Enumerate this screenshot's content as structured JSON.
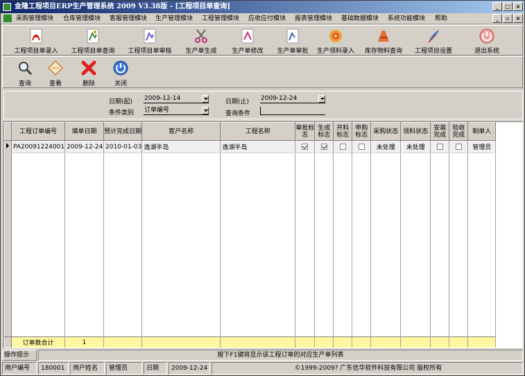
{
  "window": {
    "title": "金隆工程项目ERP生产管理系统 2009 V3.38版 - [工程项目单查询]"
  },
  "menu": [
    "采购管理模块",
    "仓库管理模块",
    "客服管理模块",
    "生产管理模块",
    "工程管理模块",
    "应收应付模块",
    "报表管理模块",
    "基础数据模块",
    "系统功能模块",
    "帮助"
  ],
  "toolbar": [
    "工程项目单录入",
    "工程项目单查询",
    "工程项目单审核",
    "生产单生成",
    "生产单修改",
    "生产单审批",
    "生产领料录入",
    "库存物料查询",
    "工程项目设置",
    "退出系统"
  ],
  "actions": [
    "查询",
    "查看",
    "删除",
    "关闭"
  ],
  "filter": {
    "date_from_label": "日期(起)",
    "date_from": "2009-12-14",
    "date_to_label": "日期(止)",
    "date_to": "2009-12-24",
    "category_label": "条件类别",
    "category": "订单编号",
    "condition_label": "查询条件",
    "condition": ""
  },
  "grid": {
    "columns": [
      "工程订单编号",
      "填单日期",
      "预计完成日期",
      "客户名称",
      "工程名称",
      "审批标志",
      "生成标志",
      "开料标志",
      "申购标志",
      "采购状态",
      "领料状态",
      "安装完成",
      "验收完成",
      "制单人"
    ],
    "rows": [
      {
        "order_no": "PA20091224001",
        "fill_date": "2009-12-24",
        "expected_date": "2010-01-03",
        "customer": "逸湖半岛",
        "project": "逸湖半岛",
        "approved": true,
        "generated": true,
        "cut": false,
        "purchase_req": false,
        "purchase_status": "未处理",
        "picking_status": "未处理",
        "installed": false,
        "accepted": false,
        "creator": "管理员"
      }
    ],
    "total_label": "订单数合计",
    "total_value": "1"
  },
  "hint": {
    "label": "操作提示",
    "message": "按下F1键将显示该工程订单的对应生产单列表"
  },
  "status": {
    "user_no_label": "用户编号",
    "user_no": "180001",
    "user_name_label": "用户姓名",
    "user_name": "管理员",
    "date_label": "日期",
    "date": "2009-12-24",
    "copyright": "©1999-2009?  广东信华软件科技有限公司  版权所有"
  },
  "colors": {
    "title_start": "#0a246a",
    "title_end": "#a6caf0",
    "total_row": "#fff8a0",
    "face": "#d4d0c8"
  },
  "icons": {
    "toolbar": [
      "pdf-doc-icon",
      "image-doc-icon",
      "image-doc-icon",
      "scissors-icon",
      "image-doc-icon",
      "image-doc-icon",
      "gear-flower-icon",
      "ruler-icon",
      "feather-icon",
      "power-icon"
    ],
    "actions": [
      "magnifier-icon",
      "note-icon",
      "red-x-icon",
      "power-icon"
    ]
  }
}
